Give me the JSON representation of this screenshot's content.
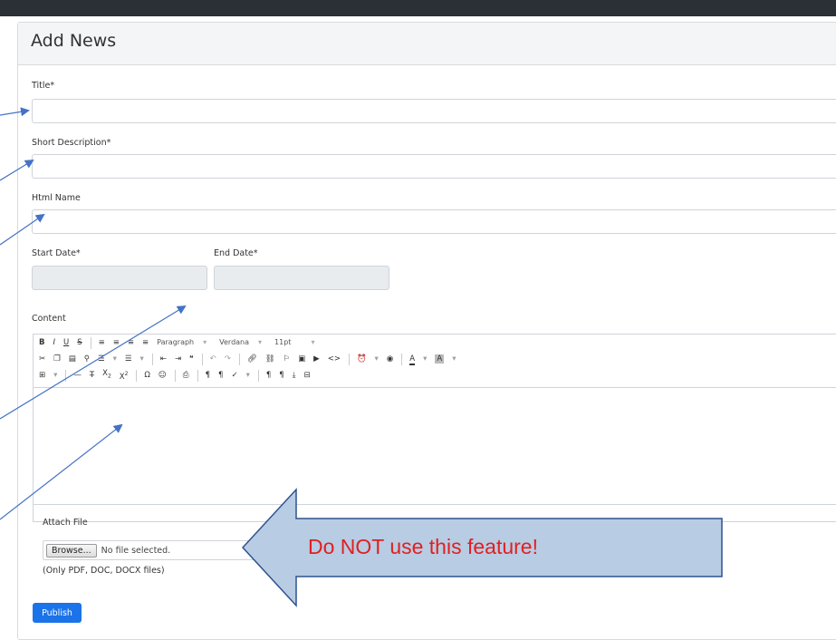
{
  "page": {
    "title": "Add News"
  },
  "form": {
    "title_label": "Title*",
    "title_value": "",
    "short_desc_label": "Short Description*",
    "short_desc_value": "",
    "html_name_label": "Html Name",
    "html_name_value": "",
    "start_date_label": "Start Date*",
    "start_date_value": "",
    "end_date_label": "End Date*",
    "end_date_value": "",
    "content_label": "Content"
  },
  "editor": {
    "toolbar_row1": {
      "bold": "B",
      "italic": "I",
      "underline": "U",
      "strike": "S",
      "format_select": "Paragraph",
      "font_select": "Verdana",
      "size_select": "11pt"
    },
    "toolbar_row2": {
      "text_color": "A",
      "bg_color": "A"
    },
    "toolbar_row3": {
      "subscript": "X",
      "superscript": "X",
      "omega": "Ω"
    }
  },
  "attach": {
    "label": "Attach File",
    "browse_label": "Browse...",
    "file_status": "No file selected.",
    "hint": "(Only PDF, DOC, DOCX files)"
  },
  "publish_label": "Publish",
  "annotation": {
    "warning_text": "Do NOT use this feature!"
  },
  "colors": {
    "header_bar": "#2b2f36",
    "primary_button": "#1a73e8",
    "annotation_arrow_fill": "#b8cce4",
    "annotation_arrow_stroke": "#2f528f",
    "pointer_arrow": "#4472c4",
    "warning_text": "#e02020"
  }
}
